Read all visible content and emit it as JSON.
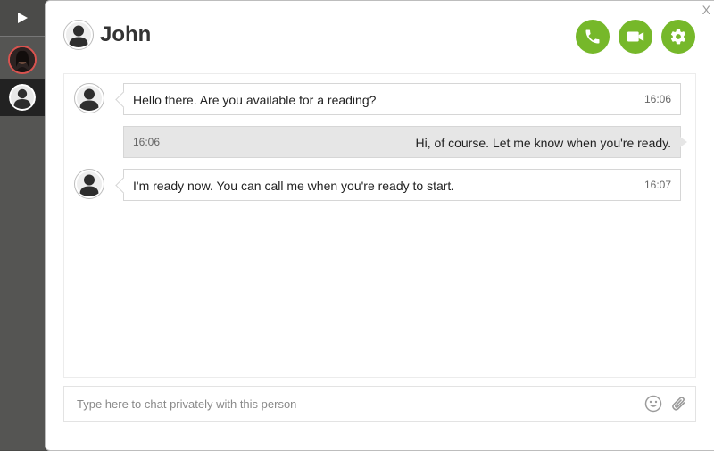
{
  "window": {
    "close_label": "X"
  },
  "header": {
    "name": "John"
  },
  "messages": [
    {
      "direction": "in",
      "text": "Hello there. Are you available for a reading?",
      "time": "16:06"
    },
    {
      "direction": "out",
      "text": "Hi, of course. Let me know when you're ready.",
      "time": "16:06"
    },
    {
      "direction": "in",
      "text": "I'm ready now. You can call me when you're ready to start.",
      "time": "16:07"
    }
  ],
  "composer": {
    "placeholder": "Type here to chat privately with this person"
  },
  "icons": {
    "play": "play-icon",
    "call": "phone-icon",
    "video": "video-camera-icon",
    "settings": "gear-icon",
    "emoji": "smiley-icon",
    "attach": "paperclip-icon"
  },
  "colors": {
    "accent": "#76b82a",
    "active_contact_ring": "#d9534f",
    "rail": "#555553"
  }
}
